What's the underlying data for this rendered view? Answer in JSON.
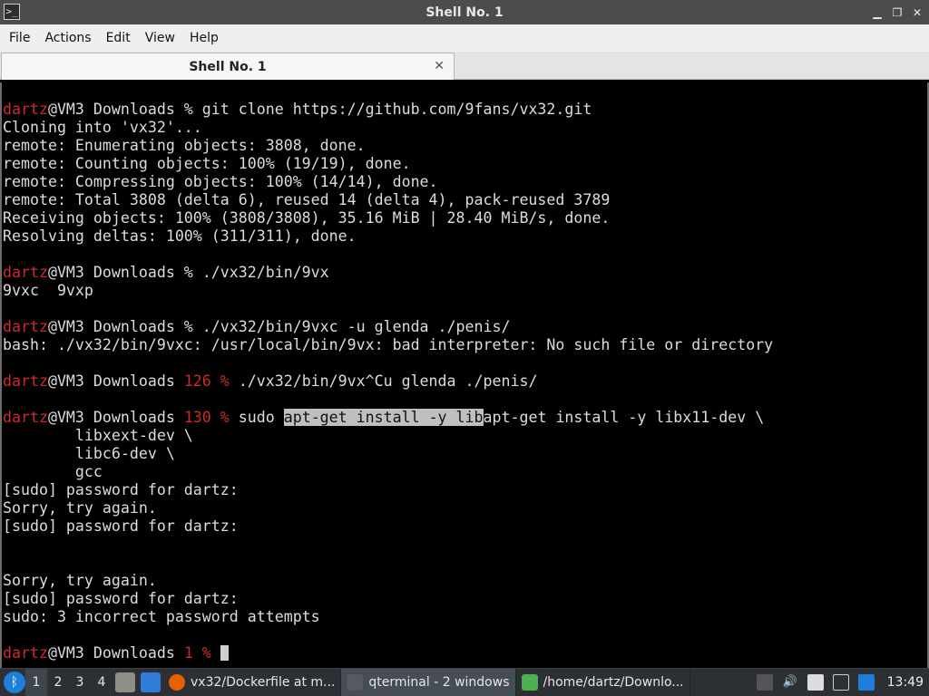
{
  "window": {
    "title": "Shell No. 1"
  },
  "menu": [
    "File",
    "Actions",
    "Edit",
    "View",
    "Help"
  ],
  "tab": {
    "label": "Shell No. 1",
    "close_glyph": "✕"
  },
  "terminal": {
    "lines": [
      [
        {
          "t": "dartz",
          "c": "user"
        },
        {
          "t": "@VM3 Downloads % git clone https://github.com/9fans/vx32.git"
        }
      ],
      [
        {
          "t": "Cloning into 'vx32'..."
        }
      ],
      [
        {
          "t": "remote: Enumerating objects: 3808, done."
        }
      ],
      [
        {
          "t": "remote: Counting objects: 100% (19/19), done."
        }
      ],
      [
        {
          "t": "remote: Compressing objects: 100% (14/14), done."
        }
      ],
      [
        {
          "t": "remote: Total 3808 (delta 6), reused 14 (delta 4), pack-reused 3789"
        }
      ],
      [
        {
          "t": "Receiving objects: 100% (3808/3808), 35.16 MiB | 28.40 MiB/s, done."
        }
      ],
      [
        {
          "t": "Resolving deltas: 100% (311/311), done."
        }
      ],
      [],
      [
        {
          "t": "dartz",
          "c": "user"
        },
        {
          "t": "@VM3 Downloads % ./vx32/bin/9vx"
        }
      ],
      [
        {
          "t": "9vxc  9vxp"
        }
      ],
      [],
      [
        {
          "t": "dartz",
          "c": "user"
        },
        {
          "t": "@VM3 Downloads % ./vx32/bin/9vxc -u glenda ./penis/"
        }
      ],
      [
        {
          "t": "bash: ./vx32/bin/9vxc: /usr/local/bin/9vx: bad interpreter: No such file or directory"
        }
      ],
      [],
      [
        {
          "t": "dartz",
          "c": "user"
        },
        {
          "t": "@VM3 Downloads "
        },
        {
          "t": "126 %",
          "c": "code"
        },
        {
          "t": " ./vx32/bin/9vx^Cu glenda ./penis/"
        }
      ],
      [],
      [
        {
          "t": "dartz",
          "c": "user"
        },
        {
          "t": "@VM3 Downloads "
        },
        {
          "t": "130 %",
          "c": "code"
        },
        {
          "t": " sudo "
        },
        {
          "t": "apt-get install -y lib",
          "c": "sel"
        },
        {
          "t": "apt-get install -y libx11-dev \\"
        }
      ],
      [
        {
          "t": "        libxext-dev \\"
        }
      ],
      [
        {
          "t": "        libc6-dev \\"
        }
      ],
      [
        {
          "t": "        gcc"
        }
      ],
      [
        {
          "t": "[sudo] password for dartz:"
        }
      ],
      [
        {
          "t": "Sorry, try again."
        }
      ],
      [
        {
          "t": "[sudo] password for dartz:"
        }
      ],
      [],
      [],
      [
        {
          "t": "Sorry, try again."
        }
      ],
      [
        {
          "t": "[sudo] password for dartz:"
        }
      ],
      [
        {
          "t": "sudo: 3 incorrect password attempts"
        }
      ],
      [],
      [
        {
          "t": "dartz",
          "c": "user"
        },
        {
          "t": "@VM3 Downloads "
        },
        {
          "t": "1 %",
          "c": "code"
        },
        {
          "t": " "
        },
        {
          "t": "",
          "c": "cursor"
        }
      ]
    ]
  },
  "taskbar": {
    "workspaces": [
      "1",
      "2",
      "3",
      "4"
    ],
    "active_workspace": "1",
    "tasks": [
      {
        "label": "vx32/Dockerfile at m...",
        "icon": "firefox-icon",
        "color": "#e66000"
      },
      {
        "label": "qterminal - 2 windows",
        "icon": "terminal-icon",
        "color": "#555a60",
        "active": true
      },
      {
        "label": "/home/dartz/Downlo...",
        "icon": "folder-icon",
        "color": "#4caf50"
      }
    ],
    "clock": "13:49",
    "colors": {
      "start": "#1f7fd8",
      "bar": "#2c2f33"
    }
  }
}
